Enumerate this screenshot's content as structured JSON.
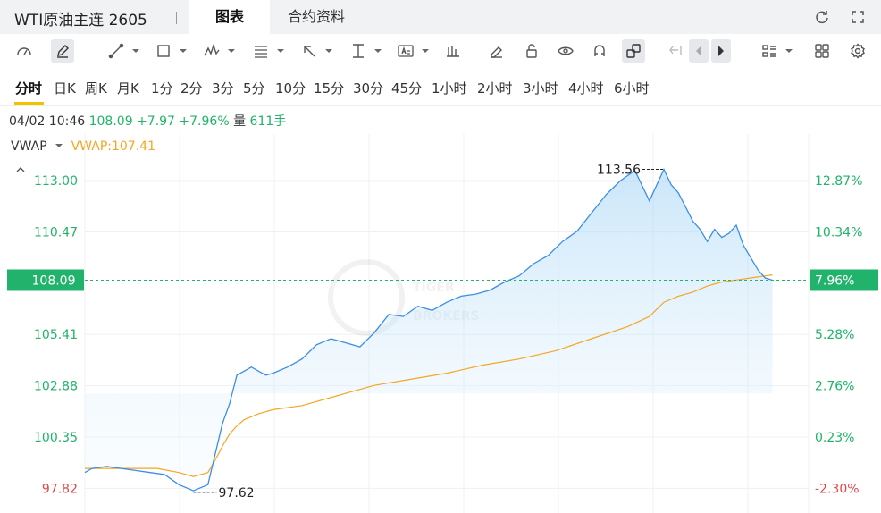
{
  "header": {
    "title": "WTI原油主连 2605",
    "tabs": [
      {
        "label": "图表",
        "active": true
      },
      {
        "label": "合约资料",
        "active": false
      }
    ]
  },
  "toolbar": {
    "icons": [
      "speedometer-icon",
      "pen-icon",
      "line-tool-icon",
      "rectangle-tool-icon",
      "wave-tool-icon",
      "fib-tool-icon",
      "arrow-tool-icon",
      "measure-tool-icon",
      "text-tool-icon",
      "bar-tool-icon",
      "eraser-icon",
      "lock-icon",
      "eye-icon",
      "magnet-icon",
      "link-icon",
      "undo-icon",
      "prev-icon",
      "next-icon",
      "layout-icon",
      "grid-icon",
      "settings-icon"
    ]
  },
  "periods": [
    "分时",
    "日K",
    "周K",
    "月K",
    "1分",
    "2分",
    "3分",
    "5分",
    "10分",
    "15分",
    "30分",
    "45分",
    "1小时",
    "2小时",
    "3小时",
    "4小时",
    "6小时"
  ],
  "active_period": "分时",
  "quote": {
    "datetime": "04/02 10:46",
    "price": "108.09",
    "change": "+7.97",
    "change_pct": "+7.96%",
    "volume_label": "量",
    "volume": "611手"
  },
  "indicator": {
    "name": "VWAP",
    "value_label": "VWAP:107.41"
  },
  "colors": {
    "up": "#21b36b",
    "down": "#e04a4a",
    "price_line": "#3a8ee6",
    "vwap_line": "#f5a623",
    "current_tag": "#21b36b"
  },
  "chart_data": {
    "type": "line",
    "y_left_ticks": [
      "113.00",
      "110.47",
      "105.41",
      "102.88",
      "100.35",
      "97.82"
    ],
    "y_right_ticks": [
      "12.87%",
      "10.34%",
      "5.28%",
      "2.76%",
      "0.23%",
      "-2.30%"
    ],
    "current_price_tag": "108.09",
    "current_pct_tag": "7.96%",
    "high_annotation": "113.56",
    "low_annotation": "97.62",
    "ylim": [
      96.6,
      115.3
    ],
    "xlim": [
      0,
      100
    ],
    "series": [
      {
        "name": "price",
        "x": [
          0,
          1,
          3,
          5,
          7,
          9,
          11,
          13,
          15,
          17,
          19,
          20,
          21,
          22,
          23,
          24,
          25,
          26,
          28,
          30,
          32,
          34,
          36,
          38,
          40,
          42,
          44,
          46,
          48,
          50,
          52,
          54,
          56,
          58,
          60,
          62,
          64,
          66,
          68,
          70,
          72,
          74,
          76,
          78,
          80,
          81,
          82,
          83,
          84,
          85,
          86,
          87,
          88,
          89,
          90,
          91,
          92,
          93,
          94,
          95
        ],
        "y": [
          98.6,
          98.8,
          98.9,
          98.8,
          98.7,
          98.6,
          98.5,
          98.0,
          97.7,
          98.0,
          101.0,
          102.0,
          103.4,
          103.6,
          103.8,
          103.6,
          103.4,
          103.5,
          103.8,
          104.2,
          104.9,
          105.2,
          105.0,
          104.8,
          105.5,
          106.4,
          106.3,
          106.8,
          106.6,
          107.0,
          107.3,
          107.4,
          107.6,
          108.0,
          108.3,
          108.9,
          109.3,
          110.0,
          110.5,
          111.4,
          112.3,
          113.0,
          113.5,
          112.0,
          113.56,
          112.8,
          112.4,
          111.7,
          111.0,
          110.6,
          110.0,
          110.6,
          110.2,
          110.4,
          110.8,
          109.8,
          109.2,
          108.6,
          108.2,
          108.09
        ]
      },
      {
        "name": "VWAP",
        "x": [
          0,
          5,
          10,
          13,
          15,
          17,
          18,
          19,
          20,
          21,
          22,
          24,
          26,
          30,
          35,
          40,
          45,
          50,
          55,
          60,
          65,
          70,
          75,
          78,
          80,
          82,
          84,
          86,
          88,
          90,
          92,
          93,
          94,
          95
        ],
        "y": [
          98.8,
          98.8,
          98.8,
          98.6,
          98.4,
          98.6,
          99.2,
          99.9,
          100.5,
          100.9,
          101.2,
          101.5,
          101.7,
          101.9,
          102.4,
          102.9,
          103.2,
          103.5,
          103.9,
          104.2,
          104.6,
          105.2,
          105.8,
          106.3,
          107.0,
          107.3,
          107.5,
          107.8,
          108.0,
          108.1,
          108.2,
          108.25,
          108.3,
          108.35
        ]
      }
    ]
  }
}
